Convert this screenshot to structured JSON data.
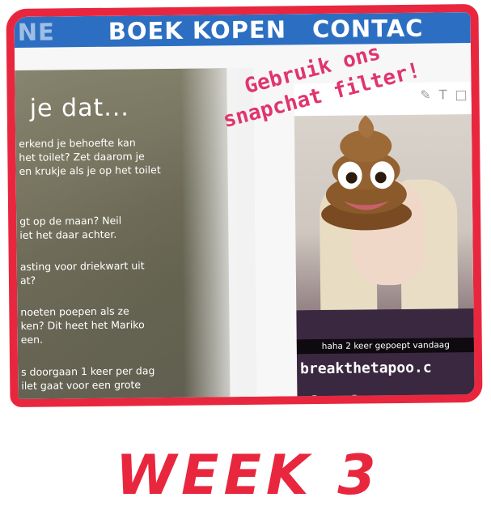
{
  "nav": {
    "items": [
      "NE",
      "BOEK KOPEN",
      "CONTAC"
    ]
  },
  "article": {
    "title": "je dat...",
    "facts": [
      "erkend je behoefte kan\nhet toilet? Zet daarom je\nen krukje als je op het toilet",
      "gt op de maan? Neil\niet het daar achter.",
      "asting voor driekwart uit\nat?",
      "noeten poepen als ze\nken? Dit heet het Mariko\neen.",
      "s doorgaan 1 keer per dag\nilet gaat voor een grote"
    ]
  },
  "snapchat": {
    "caption": "haha 2 keer gepoept vandaag",
    "hashtag": "breakthetapoo.c",
    "tool_icons": [
      "pencil-icon",
      "text-icon",
      "crop-icon"
    ]
  },
  "sticker": {
    "line1": "Gebruik ons",
    "line2": "snapchat filter!"
  },
  "week_label": "WEEK 3",
  "colors": {
    "frame": "#e8273f",
    "nav": "#2c6fc2",
    "sticker": "#e0356d"
  }
}
